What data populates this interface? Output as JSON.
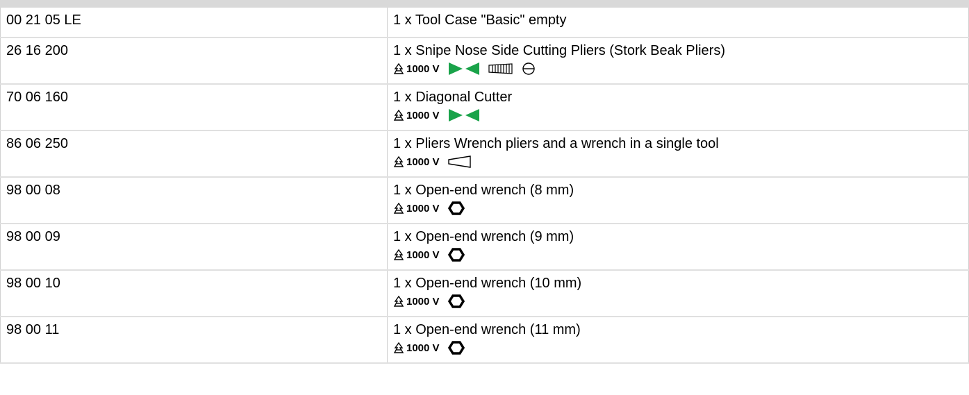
{
  "rows": [
    {
      "code": "00 21 05 LE",
      "desc": "1 x Tool Case \"Basic\" empty",
      "icons": []
    },
    {
      "code": "26 16 200",
      "desc": "1 x Snipe Nose Side Cutting Pliers (Stork Beak Pliers)",
      "volt": "1000 V",
      "icons": [
        "cutting-edges-icon",
        "gripping-zone-icon",
        "round-section-icon"
      ]
    },
    {
      "code": "70 06 160",
      "desc": "1 x Diagonal Cutter",
      "volt": "1000 V",
      "icons": [
        "cutting-edges-icon"
      ]
    },
    {
      "code": "86 06 250",
      "desc": "1 x Pliers Wrench pliers and a wrench in a single tool",
      "volt": "1000 V",
      "icons": [
        "parallel-jaws-icon"
      ]
    },
    {
      "code": "98 00 08",
      "desc": "1 x Open-end wrench (8 mm)",
      "volt": "1000 V",
      "icons": [
        "hex-nut-icon"
      ]
    },
    {
      "code": "98 00 09",
      "desc": "1 x Open-end wrench (9 mm)",
      "volt": "1000 V",
      "icons": [
        "hex-nut-icon"
      ]
    },
    {
      "code": "98 00 10",
      "desc": "1 x Open-end wrench (10 mm)",
      "volt": "1000 V",
      "icons": [
        "hex-nut-icon"
      ]
    },
    {
      "code": "98 00 11",
      "desc": "1 x Open-end wrench (11 mm)",
      "volt": "1000 V",
      "icons": [
        "hex-nut-icon"
      ]
    }
  ],
  "colors": {
    "cutter_green": "#1aa34a"
  }
}
